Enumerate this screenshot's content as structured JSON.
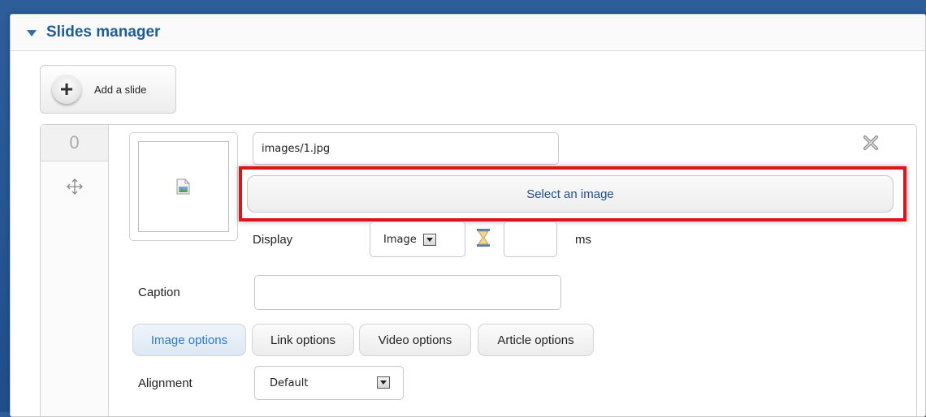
{
  "panel": {
    "title": "Slides manager"
  },
  "add_slide": {
    "label": "Add a slide"
  },
  "slide": {
    "index": "0",
    "image_path": "images/1.jpg",
    "select_image_label": "Select an image",
    "display_label": "Display",
    "display_value": "Image",
    "duration_value": "",
    "duration_unit": "ms",
    "caption_label": "Caption",
    "caption_value": "",
    "tabs": [
      {
        "label": "Image options",
        "active": true
      },
      {
        "label": "Link options",
        "active": false
      },
      {
        "label": "Video options",
        "active": false
      },
      {
        "label": "Article options",
        "active": false
      }
    ],
    "alignment_label": "Alignment",
    "alignment_value": "Default"
  },
  "colors": {
    "background": "#2d5e9a",
    "title": "#1f5d98",
    "highlight": "#e0121a",
    "active_tab_text": "#2a7ad0",
    "button_text": "#1f4e8c"
  },
  "icons": [
    "collapse-triangle-icon",
    "plus-icon",
    "move-icon",
    "broken-image-icon",
    "close-icon",
    "hourglass-icon",
    "dropdown-arrow-icon"
  ]
}
